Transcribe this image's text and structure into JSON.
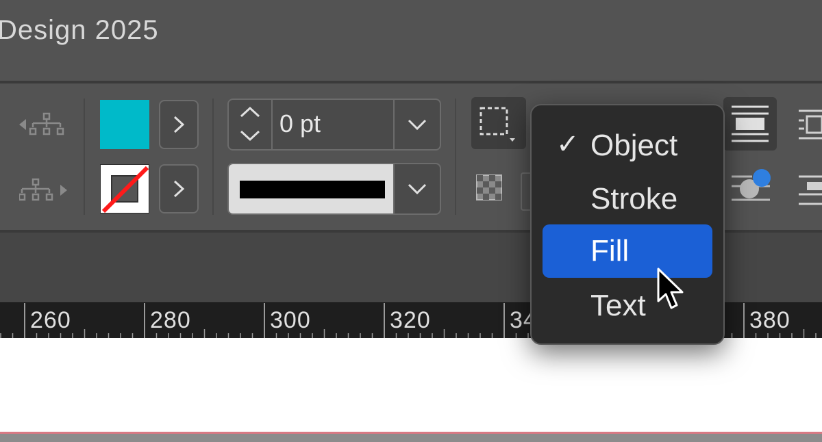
{
  "window": {
    "title": "Design 2025"
  },
  "toolbar": {
    "fill_color": "#00bac9",
    "stroke_weight": "0 pt",
    "icons": [
      "reference-point-left-icon",
      "reference-point-right-icon",
      "fill-swatch",
      "stroke-swatch-none",
      "stepper-icon",
      "chevron-down-icon",
      "frame-fitting-icon",
      "checker-icon",
      "text-wrap-icon",
      "badge-blue-dot"
    ]
  },
  "dropdown_menu": {
    "items": [
      {
        "label": "Object",
        "checked": true,
        "highlighted": false
      },
      {
        "label": "Stroke",
        "checked": false,
        "highlighted": false
      },
      {
        "label": "Fill",
        "checked": false,
        "highlighted": true
      },
      {
        "label": "Text",
        "checked": false,
        "highlighted": false
      }
    ],
    "highlight_color": "#1b60d6"
  },
  "ruler": {
    "labels": [
      "260",
      "280",
      "300",
      "320",
      "34",
      "380"
    ]
  },
  "colors": {
    "panel_bg": "#535353",
    "ruler_bg": "#1e1e1e",
    "page_edge": "#d97a84"
  }
}
